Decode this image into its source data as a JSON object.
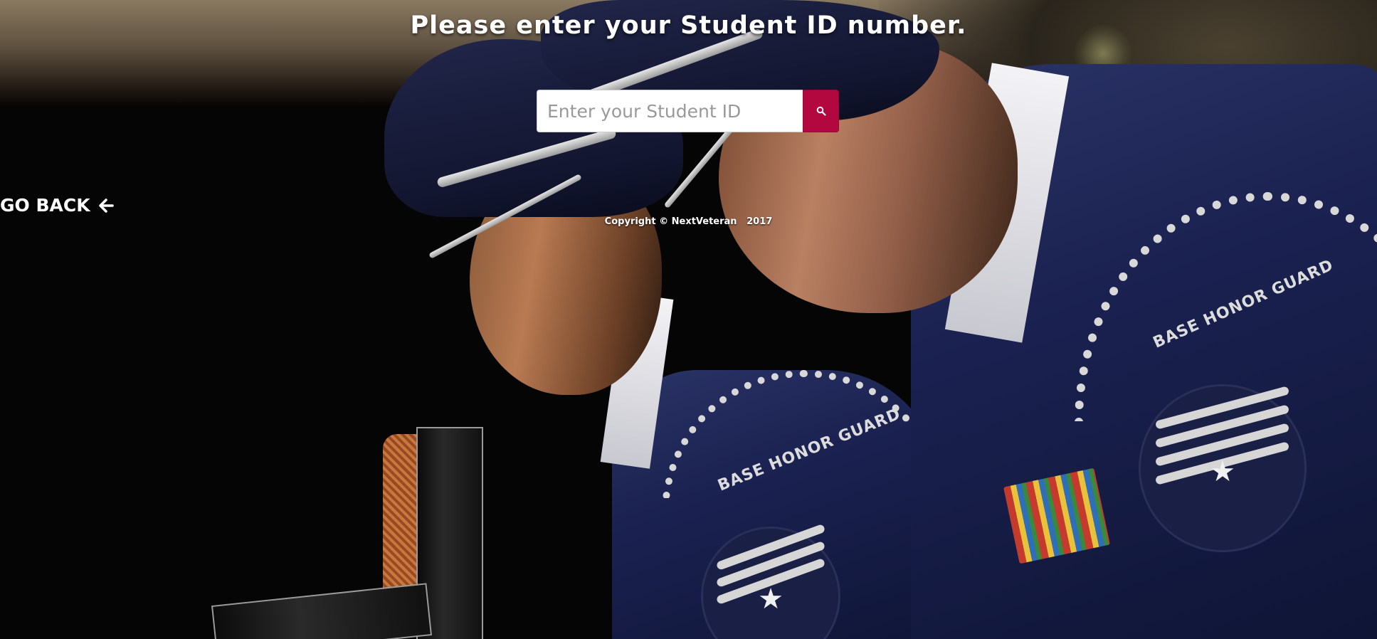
{
  "heading": "Please enter your Student ID number.",
  "search": {
    "placeholder": "Enter your Student ID",
    "value": "",
    "button_icon": "search-icon",
    "button_color": "#b3073f"
  },
  "nav": {
    "go_back_label": "GO BACK",
    "go_back_icon": "arrow-left-icon"
  },
  "footer": {
    "copyright": "Copyright © NextVeteran   2017"
  },
  "background": {
    "patch_text": "BASE HONOR GUARD"
  }
}
